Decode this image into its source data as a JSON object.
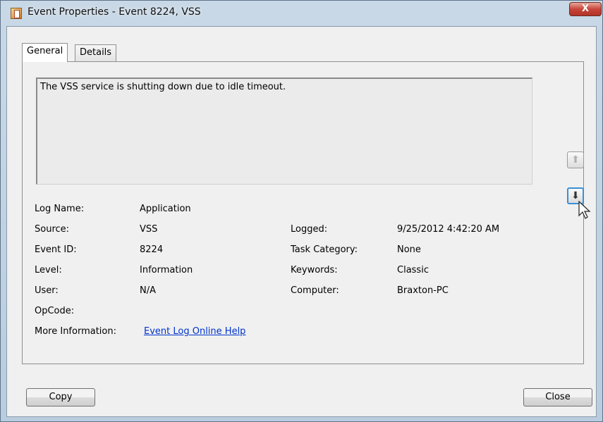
{
  "window": {
    "title": "Event Properties - Event 8224, VSS",
    "close_glyph": "X"
  },
  "tabs": [
    {
      "label": "General",
      "active": true
    },
    {
      "label": "Details",
      "active": false
    }
  ],
  "message": "The VSS service is shutting down due to idle timeout.",
  "fields": {
    "log_name": {
      "label": "Log Name:",
      "value": "Application"
    },
    "source": {
      "label": "Source:",
      "value": "VSS"
    },
    "event_id": {
      "label": "Event ID:",
      "value": "8224"
    },
    "level": {
      "label": "Level:",
      "value": "Information"
    },
    "user": {
      "label": "User:",
      "value": "N/A"
    },
    "opcode": {
      "label": "OpCode:",
      "value": ""
    },
    "more_info": {
      "label": "More Information:",
      "value": "Event Log Online Help"
    },
    "logged": {
      "label": "Logged:",
      "value": "9/25/2012 4:42:20 AM"
    },
    "task_category": {
      "label": "Task Category:",
      "value": "None"
    },
    "keywords": {
      "label": "Keywords:",
      "value": "Classic"
    },
    "computer": {
      "label": "Computer:",
      "value": "Braxton-PC"
    }
  },
  "nav": {
    "up_glyph": "⬆",
    "down_glyph": "⬇"
  },
  "buttons": {
    "copy": "Copy",
    "close": "Close"
  },
  "icons": {
    "app": "event-viewer-icon",
    "close": "close-icon",
    "up": "arrow-up-icon",
    "down": "arrow-down-icon",
    "cursor": "mouse-pointer-icon"
  }
}
